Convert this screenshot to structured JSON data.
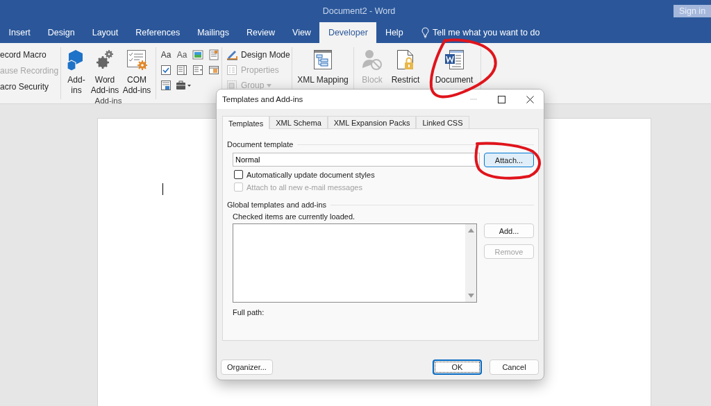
{
  "window": {
    "title": "Document2  -  Word",
    "sign_in": "Sign in"
  },
  "ribbon_tabs": [
    {
      "label": "Insert",
      "selected": false
    },
    {
      "label": "Design",
      "selected": false
    },
    {
      "label": "Layout",
      "selected": false
    },
    {
      "label": "References",
      "selected": false
    },
    {
      "label": "Mailings",
      "selected": false
    },
    {
      "label": "Review",
      "selected": false
    },
    {
      "label": "View",
      "selected": false
    },
    {
      "label": "Developer",
      "selected": true
    },
    {
      "label": "Help",
      "selected": false
    }
  ],
  "tell_me": "Tell me what you want to do",
  "code_group": [
    {
      "label": "ecord Macro",
      "disabled": false
    },
    {
      "label": "ause Recording",
      "disabled": true
    },
    {
      "label": "acro Security",
      "disabled": false
    }
  ],
  "addins_group": {
    "label": "Add-ins",
    "buttons": [
      {
        "kind": "addins",
        "label": "Add-ins"
      },
      {
        "kind": "word",
        "label": "Word Add-ins"
      },
      {
        "kind": "com",
        "label": "COM Add-ins"
      }
    ]
  },
  "controls": [
    {
      "kind": "glyph",
      "glyph": "Aa"
    },
    {
      "kind": "glyph-plain",
      "glyph": "Aa"
    },
    {
      "kind": "picture"
    },
    {
      "kind": "gallery"
    },
    {
      "kind": "checkbox"
    },
    {
      "kind": "combo"
    },
    {
      "kind": "list"
    },
    {
      "kind": "date"
    },
    {
      "kind": "repeat"
    },
    {
      "kind": "tools"
    }
  ],
  "design_group": [
    {
      "kind": "design",
      "label": "Design Mode",
      "disabled": false,
      "dropdown": false
    },
    {
      "kind": "properties",
      "label": "Properties",
      "disabled": true,
      "dropdown": false
    },
    {
      "kind": "group",
      "label": "Group",
      "disabled": true,
      "dropdown": true
    }
  ],
  "big_buttons": [
    {
      "kind": "xml",
      "label": "XML Mapping",
      "disabled": false
    },
    {
      "kind": "block",
      "label": "Block",
      "disabled": true
    },
    {
      "kind": "restrict",
      "label": "Restrict",
      "disabled": false
    },
    {
      "kind": "template",
      "label": "Document",
      "disabled": false
    }
  ],
  "dialog": {
    "title": "Templates and Add-ins",
    "tabs": [
      {
        "label": "Templates",
        "selected": true
      },
      {
        "label": "XML Schema",
        "selected": false
      },
      {
        "label": "XML Expansion Packs",
        "selected": false
      },
      {
        "label": "Linked CSS",
        "selected": false
      }
    ],
    "document_template": {
      "heading": "Document template",
      "value": "Normal",
      "attach": {
        "label": "Attach...",
        "hovered": true
      },
      "options": [
        {
          "label": "Automatically update document styles",
          "checked": false,
          "disabled": false
        },
        {
          "label": "Attach to all new e-mail messages",
          "checked": false,
          "disabled": true
        }
      ]
    },
    "global": {
      "heading": "Global templates and add-ins",
      "hint": "Checked items are currently loaded.",
      "side_buttons": [
        {
          "label": "Add...",
          "disabled": false
        },
        {
          "label": "Remove",
          "disabled": true
        }
      ],
      "full_path": "Full path:"
    },
    "buttons": [
      {
        "label": "Organizer...",
        "default": false
      },
      {
        "label": "OK",
        "default": true
      },
      {
        "label": "Cancel",
        "default": false
      }
    ]
  }
}
